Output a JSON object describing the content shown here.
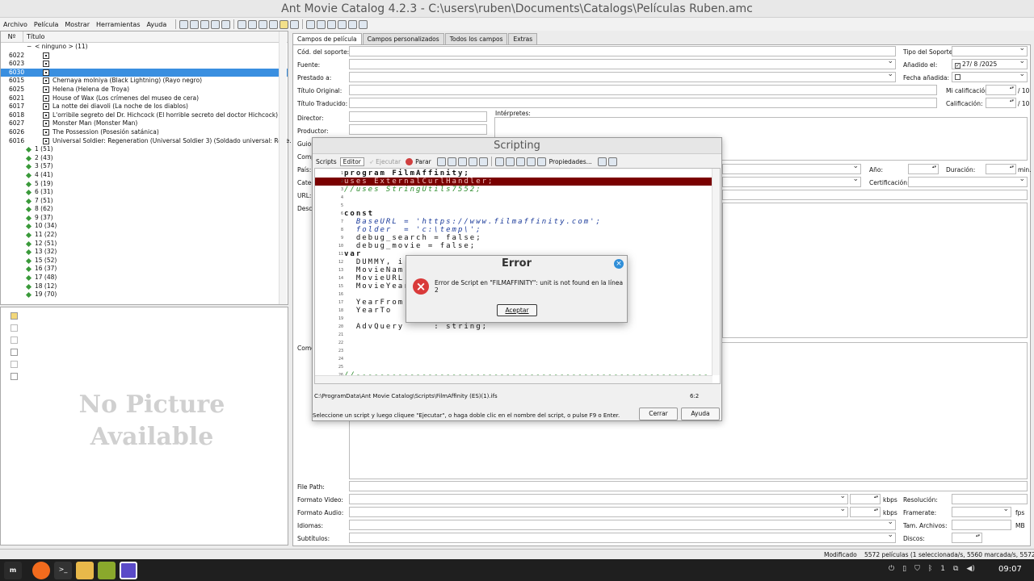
{
  "window": {
    "title": "Ant Movie Catalog 4.2.3 - C:\\users\\ruben\\Documents\\Catalogs\\Películas Ruben.amc"
  },
  "menu": [
    "Archivo",
    "Película",
    "Mostrar",
    "Herramientas",
    "Ayuda"
  ],
  "list": {
    "col_num": "Nº",
    "col_title": "Título",
    "group_header": "< ninguno > (11)",
    "movies": [
      {
        "num": "6022",
        "title": ""
      },
      {
        "num": "6023",
        "title": ""
      },
      {
        "num": "6030",
        "title": "",
        "selected": true
      },
      {
        "num": "6015",
        "title": "Chernaya molniya (Black Lightning) (Rayo negro)"
      },
      {
        "num": "6025",
        "title": "Helena (Helena de Troya)"
      },
      {
        "num": "6021",
        "title": "House of Wax (Los crímenes del museo de cera)"
      },
      {
        "num": "6017",
        "title": "La notte dei diavoli (La noche de los diablos)"
      },
      {
        "num": "6018",
        "title": "L'orribile segreto del Dr. Hichcock (El horrible secreto del doctor Hichcock)"
      },
      {
        "num": "6027",
        "title": "Monster Man (Monster Man)"
      },
      {
        "num": "6026",
        "title": "The Possession (Posesión satánica)"
      },
      {
        "num": "6016",
        "title": "Universal Soldier: Regeneration (Universal Soldier 3) (Soldado universal: Rege..."
      }
    ],
    "groups": [
      "1 (51)",
      "2 (43)",
      "3 (57)",
      "4 (41)",
      "5 (19)",
      "6 (31)",
      "7 (51)",
      "8 (62)",
      "9 (37)",
      "10 (34)",
      "11 (22)",
      "12 (51)",
      "13 (32)",
      "15 (52)",
      "16 (37)",
      "17 (48)",
      "18 (12)",
      "19 (70)"
    ]
  },
  "picture": {
    "placeholder_line1": "No Picture",
    "placeholder_line2": "Available"
  },
  "tabs": [
    "Campos de película",
    "Campos personalizados",
    "Todos los campos",
    "Extras"
  ],
  "fields": {
    "cod_soporte": "Cód. del soporte:",
    "tipo_soporte": "Tipo del Soporte:",
    "fuente": "Fuente:",
    "anadido": "Añadido el:",
    "anadido_value": "27/ 8 /2025",
    "prestado": "Prestado a:",
    "fecha_anadida": "Fecha añadida:",
    "titulo_original": "Título Original:",
    "mi_calificacion": "Mi calificación:",
    "calif_suffix": "/ 10",
    "titulo_traducido": "Título Traducido:",
    "calificacion": "Calificación:",
    "director": "Director:",
    "interpretes": "Intérpretes:",
    "productor": "Productor:",
    "guion": "Guion",
    "comp": "Comp",
    "pais": "País:",
    "categ": "Categ",
    "url": "URL:",
    "descr": "Descr",
    "come": "Come",
    "anio": "Año:",
    "duracion": "Duración:",
    "min": "min.",
    "certificacion": "Certificación:",
    "file_path": "File Path:",
    "formato_video": "Formato Video:",
    "formato_audio": "Formato Audio:",
    "kbps": "kbps",
    "resolucion": "Resolución:",
    "framerate": "Framerate:",
    "fps": "fps",
    "idiomas": "Idiomas:",
    "tam_archivos": "Tam. Archivos:",
    "mb": "MB",
    "subtitulos": "Subtítulos:",
    "discos": "Discos:"
  },
  "scripting": {
    "title": "Scripting",
    "tab_scripts": "Scripts",
    "tab_editor": "Editor",
    "btn_ejecutar": "Ejecutar",
    "btn_parar": "Parar",
    "btn_propiedades": "Propiedades...",
    "code": [
      {
        "n": "1",
        "t": "program FilmAffinity;",
        "style": "kwline"
      },
      {
        "n": "2",
        "t": "uses ExternalCurlHandler;",
        "style": "hl"
      },
      {
        "n": "3",
        "t": "//uses StringUtils7552;",
        "style": "cmt"
      },
      {
        "n": "4",
        "t": "",
        "style": ""
      },
      {
        "n": "5",
        "t": "",
        "style": ""
      },
      {
        "n": "6",
        "t": "const",
        "style": "kw"
      },
      {
        "n": "7",
        "t": "  BaseURL = 'https://www.filmaffinity.com';",
        "style": "strline"
      },
      {
        "n": "8",
        "t": "  folder  = 'c:\\temp\\';",
        "style": "strline"
      },
      {
        "n": "9",
        "t": "  debug_search = false;",
        "style": ""
      },
      {
        "n": "10",
        "t": "  debug_movie = false;",
        "style": ""
      },
      {
        "n": "11",
        "t": "var",
        "style": "kw"
      },
      {
        "n": "12",
        "t": "  DUMMY, i",
        "style": ""
      },
      {
        "n": "13",
        "t": "  MovieNam",
        "style": ""
      },
      {
        "n": "14",
        "t": "  MovieURL",
        "style": ""
      },
      {
        "n": "15",
        "t": "  MovieYear",
        "style": ""
      },
      {
        "n": "16",
        "t": "",
        "style": ""
      },
      {
        "n": "17",
        "t": "  YearFrom",
        "style": ""
      },
      {
        "n": "18",
        "t": "  YearTo",
        "style": ""
      },
      {
        "n": "19",
        "t": "",
        "style": ""
      },
      {
        "n": "20",
        "t": "  AdvQuery     : string;",
        "style": ""
      },
      {
        "n": "21",
        "t": "",
        "style": ""
      },
      {
        "n": "22",
        "t": "",
        "style": ""
      },
      {
        "n": "23",
        "t": "",
        "style": ""
      },
      {
        "n": "24",
        "t": "",
        "style": ""
      },
      {
        "n": "25",
        "t": "",
        "style": ""
      },
      {
        "n": "26",
        "t": "//-----------------------------------------------------------",
        "style": "cmt"
      }
    ],
    "path": "C:\\ProgramData\\Ant Movie Catalog\\Scripts\\FilmAffinity (ES)(1).ifs",
    "cursor_pos": "6:2",
    "hint": "Seleccione un script y luego cliquee \"Ejecutar\", o haga doble clic en el nombre del script, o pulse F9 o Enter.",
    "btn_cerrar": "Cerrar",
    "btn_ayuda": "Ayuda"
  },
  "error": {
    "title": "Error",
    "message": "Error de Script en \"FILMAFFINITY\": unit is not found en la línea 2",
    "btn_ok": "Aceptar"
  },
  "status": {
    "state": "Modificado",
    "counts": "5572 películas (1 seleccionada/s, 5560 marcada/s, 5572 visible/"
  },
  "taskbar": {
    "clock": "09:07",
    "workspace": "1"
  },
  "colors": {
    "selection": "#3a8fe0",
    "error_highlight": "#7a0000",
    "taskbar": "#1f1f1f"
  }
}
